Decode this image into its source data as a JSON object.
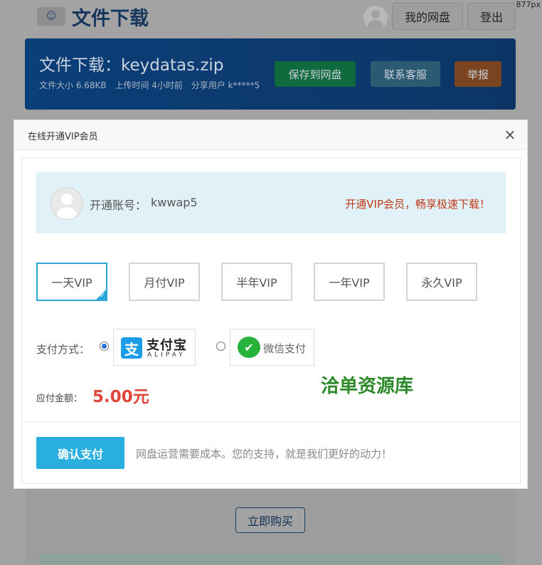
{
  "background": {
    "site_title": "文件下载",
    "top_buttons": {
      "pan": "我的网盘",
      "logout": "登出"
    },
    "corner_tag": "877px",
    "file": {
      "title": "文件下载：keydatas.zip",
      "meta_size": "文件大小 6.68KB",
      "meta_time": "上传时间 4小时前",
      "meta_user": "分享用户 k*****5",
      "save_label": "保存到网盘",
      "service_label": "联系客服",
      "report_label": "举报"
    },
    "buy_label": "立即购买"
  },
  "modal": {
    "title": "在线开通VIP会员",
    "close_icon": "×",
    "account_label": "开通账号：",
    "account_name": "kwwap5",
    "promo": "开通VIP会员，畅享极速下载！",
    "plans": [
      {
        "label": "一天VIP",
        "selected": true
      },
      {
        "label": "月付VIP",
        "selected": false
      },
      {
        "label": "半年VIP",
        "selected": false
      },
      {
        "label": "一年VIP",
        "selected": false
      },
      {
        "label": "永久VIP",
        "selected": false
      }
    ],
    "payment_label": "支付方式：",
    "payment_methods": [
      {
        "id": "alipay",
        "logo_glyph": "支",
        "cn": "支付宝",
        "en": "ALIPAY",
        "checked": true
      },
      {
        "id": "wechat",
        "logo_glyph": "✔",
        "label": "微信支付",
        "checked": false
      }
    ],
    "watermark": "洽单资源库",
    "amount_label": "应付金额：",
    "amount_value": "5.00元",
    "confirm_label": "确认支付",
    "footer_note": "网盘运营需要成本。您的支持，就是我们更好的动力！"
  },
  "colors": {
    "accent": "#2aaedd",
    "promo": "#c23a1a",
    "amount": "#e0453a",
    "watermark": "#2c8a28"
  }
}
